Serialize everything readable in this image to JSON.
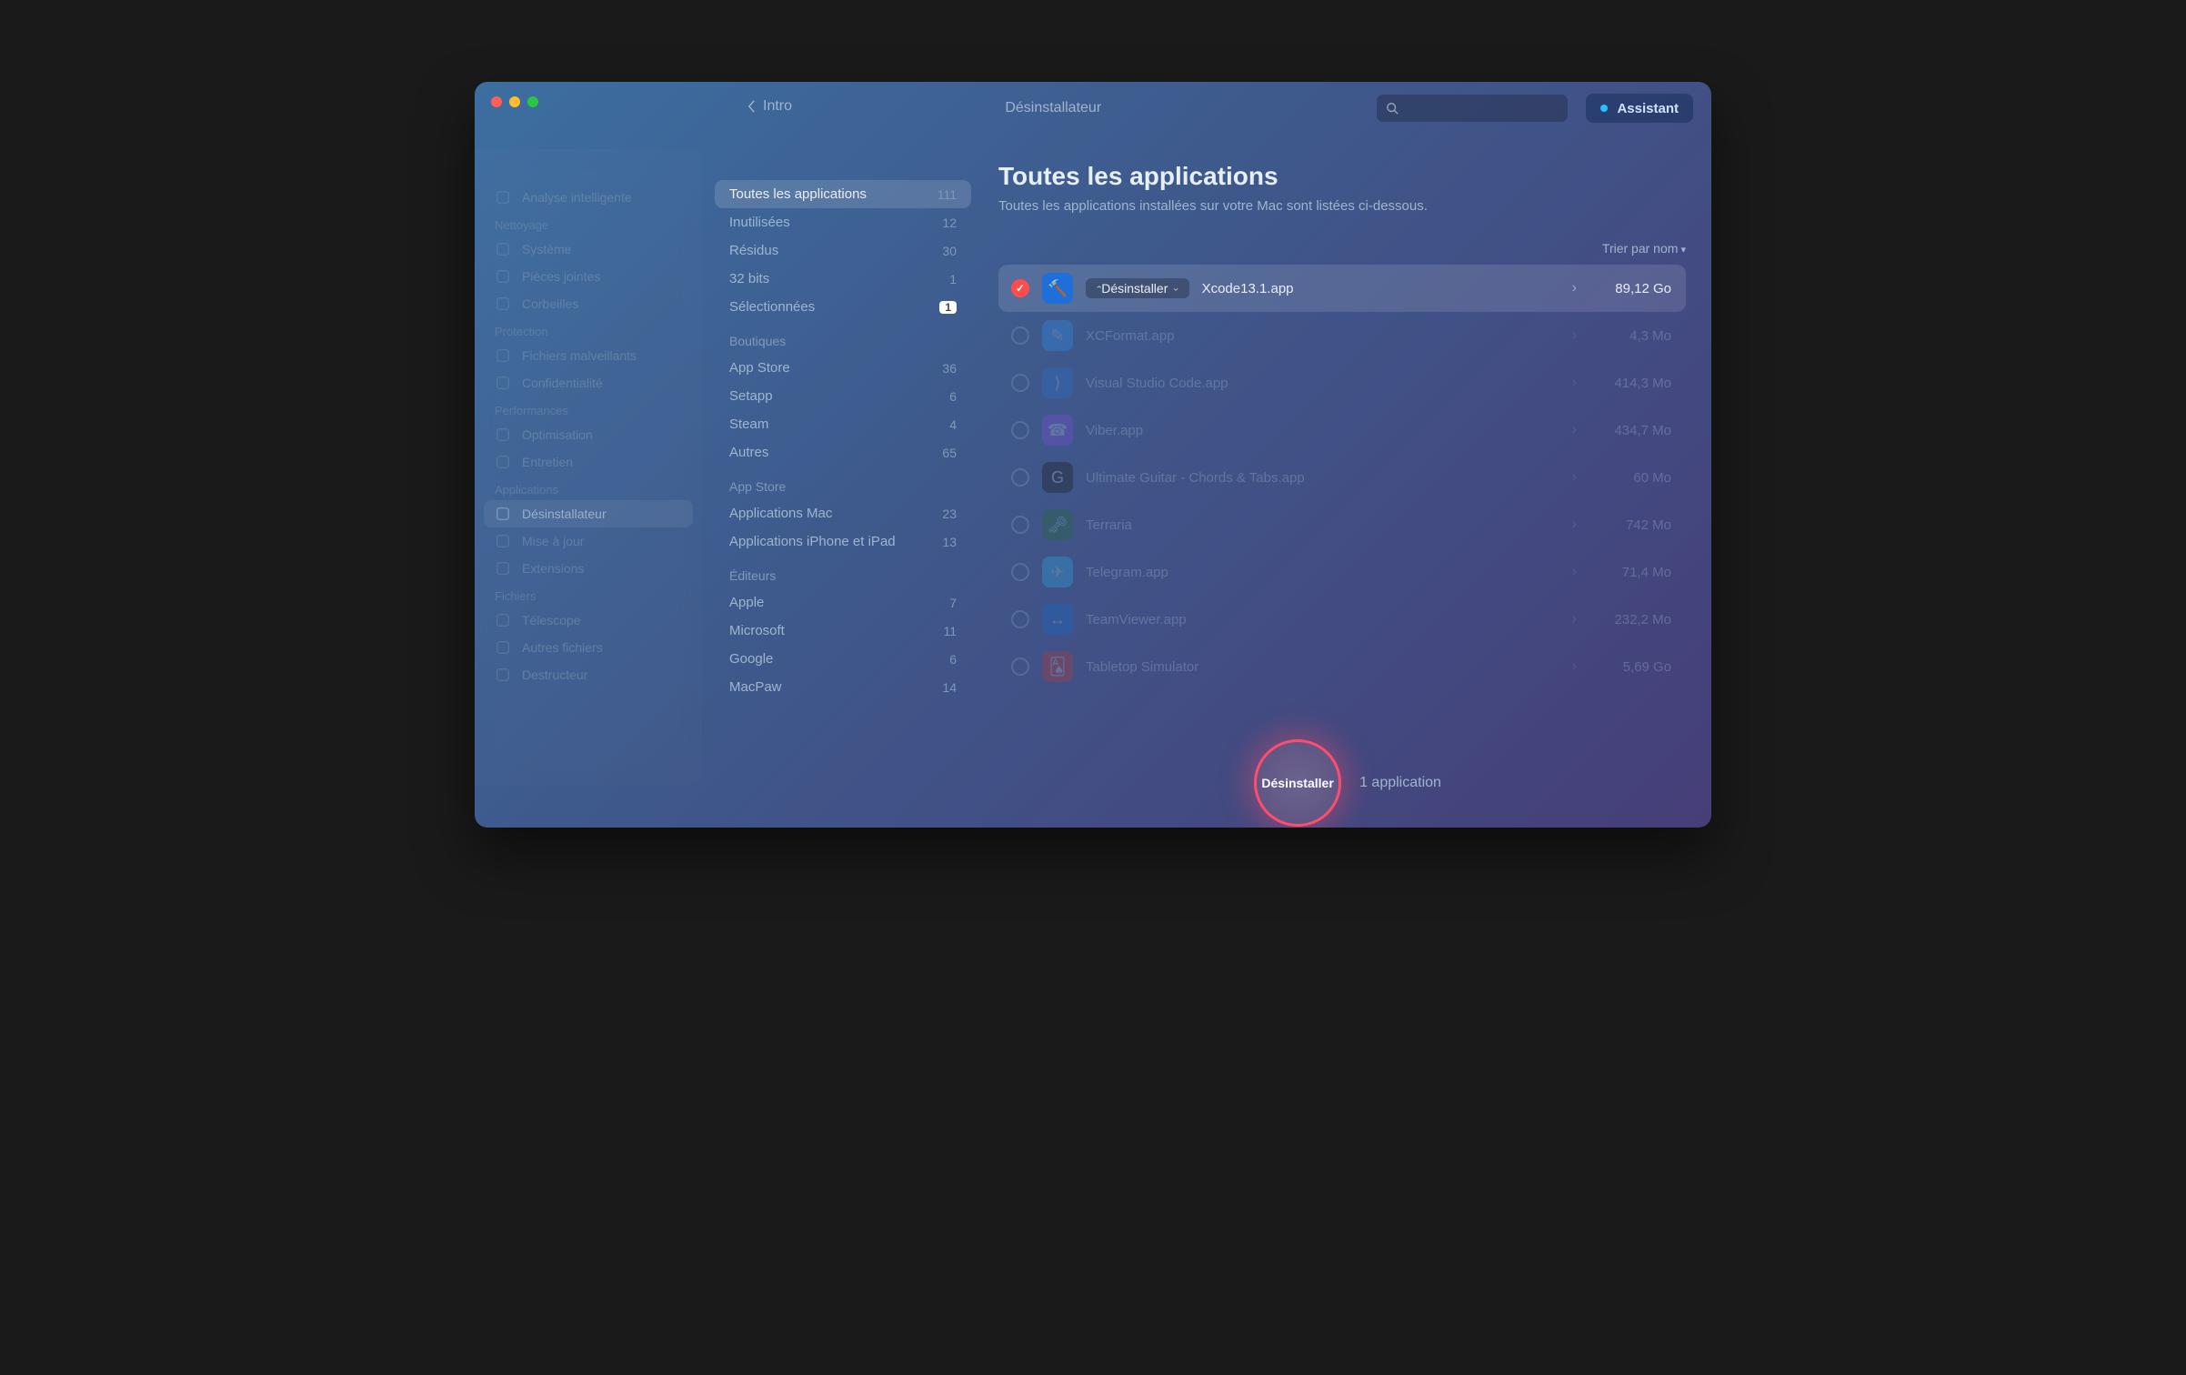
{
  "header": {
    "back_label": "Intro",
    "title": "Désinstallateur",
    "assistant_label": "Assistant"
  },
  "sidebar": {
    "groups": [
      {
        "header": null,
        "items": [
          {
            "label": "Analyse intelligente"
          }
        ]
      },
      {
        "header": "Nettoyage",
        "items": [
          {
            "label": "Système"
          },
          {
            "label": "Pièces jointes"
          },
          {
            "label": "Corbeilles"
          }
        ]
      },
      {
        "header": "Protection",
        "items": [
          {
            "label": "Fichiers malveillants"
          },
          {
            "label": "Confidentialité"
          }
        ]
      },
      {
        "header": "Performances",
        "items": [
          {
            "label": "Optimisation"
          },
          {
            "label": "Entretien"
          }
        ]
      },
      {
        "header": "Applications",
        "items": [
          {
            "label": "Désinstallateur",
            "selected": true
          },
          {
            "label": "Mise à jour"
          },
          {
            "label": "Extensions"
          }
        ]
      },
      {
        "header": "Fichiers",
        "items": [
          {
            "label": "Télescope"
          },
          {
            "label": "Autres fichiers"
          },
          {
            "label": "Destructeur"
          }
        ]
      }
    ]
  },
  "categories": {
    "groups": [
      {
        "header": null,
        "items": [
          {
            "label": "Toutes les applications",
            "count": "111",
            "selected": true
          },
          {
            "label": "Inutilisées",
            "count": "12"
          },
          {
            "label": "Résidus",
            "count": "30"
          },
          {
            "label": "32 bits",
            "count": "1"
          },
          {
            "label": "Sélectionnées",
            "count": "1",
            "badge": true
          }
        ]
      },
      {
        "header": "Boutiques",
        "items": [
          {
            "label": "App Store",
            "count": "36"
          },
          {
            "label": "Setapp",
            "count": "6"
          },
          {
            "label": "Steam",
            "count": "4"
          },
          {
            "label": "Autres",
            "count": "65"
          }
        ]
      },
      {
        "header": "App Store",
        "items": [
          {
            "label": "Applications Mac",
            "count": "23"
          },
          {
            "label": "Applications iPhone et iPad",
            "count": "13"
          }
        ]
      },
      {
        "header": "Éditeurs",
        "items": [
          {
            "label": "Apple",
            "count": "7"
          },
          {
            "label": "Microsoft",
            "count": "11"
          },
          {
            "label": "Google",
            "count": "6"
          },
          {
            "label": "MacPaw",
            "count": "14"
          }
        ]
      }
    ]
  },
  "main": {
    "title": "Toutes les applications",
    "subtitle": "Toutes les applications installées sur votre Mac sont listées ci-dessous.",
    "sort_label": "Trier par nom",
    "action_pill": "Désinstaller",
    "rows": [
      {
        "name": "Xcode13.1.app",
        "size": "89,12 Go",
        "selected": true,
        "icon_color": "#1e6fd9",
        "icon_glyph": "🔨"
      },
      {
        "name": "XCFormat.app",
        "size": "4,3 Mo",
        "icon_color": "#2f8de6",
        "icon_glyph": "✎"
      },
      {
        "name": "Visual Studio Code.app",
        "size": "414,3 Mo",
        "icon_color": "#2b6fc7",
        "icon_glyph": "⟩"
      },
      {
        "name": "Viber.app",
        "size": "434,7 Mo",
        "icon_color": "#7b4dd6",
        "icon_glyph": "☎"
      },
      {
        "name": "Ultimate Guitar - Chords & Tabs.app",
        "size": "60 Mo",
        "icon_color": "#1b1b1b",
        "icon_glyph": "G"
      },
      {
        "name": "Terraria",
        "size": "742 Mo",
        "icon_color": "#1f6b3a",
        "icon_glyph": "🗝"
      },
      {
        "name": "Telegram.app",
        "size": "71,4 Mo",
        "icon_color": "#2aa7e0",
        "icon_glyph": "✈"
      },
      {
        "name": "TeamViewer.app",
        "size": "232,2 Mo",
        "icon_color": "#1668c7",
        "icon_glyph": "↔"
      },
      {
        "name": "Tabletop Simulator",
        "size": "5,69 Go",
        "icon_color": "#b23a3a",
        "icon_glyph": "🂡"
      }
    ],
    "big_button": "Désinstaller",
    "app_count_label": "1 application"
  }
}
